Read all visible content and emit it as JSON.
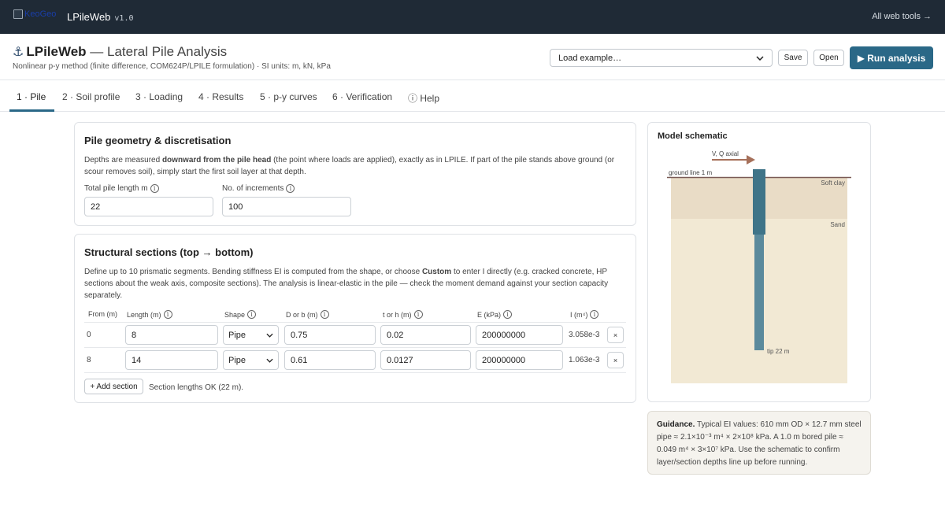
{
  "topbar": {
    "logo_alt": "KeoGeo",
    "brand": "LPileWeb",
    "version": "v1.0",
    "all_tools": "All web tools →"
  },
  "header": {
    "title_bold": "LPileWeb",
    "title_rest": "— Lateral Pile Analysis",
    "subtitle": "Nonlinear p-y method (finite difference, COM624P/LPILE formulation) · SI units: m, kN, kPa",
    "example_select": "Load example…",
    "save_label": "Save",
    "open_label": "Open",
    "run_label": "▶ Run analysis"
  },
  "tabs": [
    {
      "label": "1 · Pile",
      "active": true
    },
    {
      "label": "2 · Soil profile"
    },
    {
      "label": "3 · Loading"
    },
    {
      "label": "4 · Results"
    },
    {
      "label": "5 · p-y curves"
    },
    {
      "label": "6 · Verification"
    },
    {
      "label": "ⓘ Help"
    }
  ],
  "geometry": {
    "title": "Pile geometry & discretisation",
    "desc_a": "Depths are measured ",
    "desc_b": "downward from the pile head",
    "desc_c": " (the point where loads are applied), exactly as in LPILE. If part of the pile stands above ground (or scour removes soil), simply start the first soil layer at that depth.",
    "length_label": "Total pile length m",
    "length_value": "22",
    "increments_label": "No. of increments",
    "increments_value": "100"
  },
  "sections": {
    "title": "Structural sections (top → bottom)",
    "desc_a": "Define up to 10 prismatic segments. Bending stiffness EI is computed from the shape, or choose ",
    "desc_b": "Custom",
    "desc_c": " to enter I directly (e.g. cracked concrete, HP sections about the weak axis, composite sections). The analysis is linear-elastic in the pile — check the moment demand against your section capacity separately.",
    "columns": [
      "From (m)",
      "Length (m)",
      "Shape",
      "D or b (m)",
      "t or h (m)",
      "E (kPa)",
      "I (m⁴)"
    ],
    "rows": [
      {
        "from": "0",
        "length": "8",
        "shape": "Pipe",
        "d": "0.75",
        "t": "0.02",
        "e": "200000000",
        "i": "3.058e-3"
      },
      {
        "from": "8",
        "length": "14",
        "shape": "Pipe",
        "d": "0.61",
        "t": "0.0127",
        "e": "200000000",
        "i": "1.063e-3"
      }
    ],
    "remove_label": "×",
    "add_label": "+ Add section",
    "status": "Section lengths OK (22 m)."
  },
  "schematic": {
    "title": "Model schematic",
    "load_label": "V, Q axial",
    "ground_label": "ground line 1 m",
    "layer1": "Soft clay",
    "layer2": "Sand",
    "tip_label": "tip 22 m",
    "colors": {
      "clay": "#e9dcc6",
      "sand": "#f2e9d4",
      "pile_top": "#3f7488",
      "pile_bottom": "#5b8a9c",
      "ground_line": "#7a5a55",
      "arrow": "#a6705a"
    }
  },
  "guidance": {
    "bold": "Guidance.",
    "text": " Typical EI values: 610 mm OD × 12.7 mm steel pipe ≈ 2.1×10⁻³ m⁴ × 2×10⁸ kPa. A 1.0 m bored pile ≈ 0.049 m⁴ × 3×10⁷ kPa. Use the schematic to confirm layer/section depths line up before running."
  }
}
